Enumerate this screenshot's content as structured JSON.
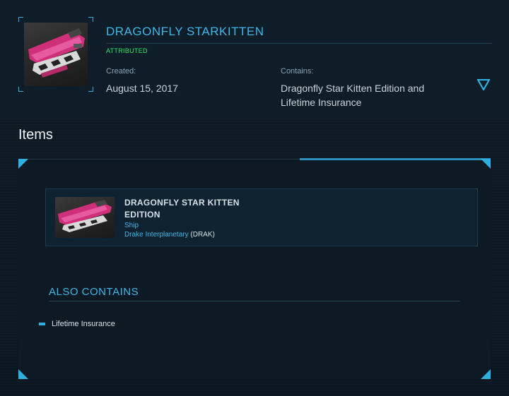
{
  "pledge": {
    "title": "DRAGONFLY STARKITTEN",
    "status": "ATTRIBUTED",
    "created_label": "Created:",
    "created_value": "August 15, 2017",
    "contains_label": "Contains:",
    "contains_value": "Dragonfly Star Kitten Edition and Lifetime Insurance",
    "expand_icon": "triangle-down-icon"
  },
  "items_section": {
    "heading": "Items",
    "items": [
      {
        "name": "DRAGONFLY STAR KITTEN EDITION",
        "type": "Ship",
        "manufacturer": "Drake Interplanetary",
        "manufacturer_code": "(DRAK)"
      }
    ],
    "also_contains_heading": "ALSO CONTAINS",
    "also_contains": [
      "Lifetime Insurance"
    ]
  },
  "colors": {
    "accent": "#3fb6e8",
    "status_green": "#2ee66b",
    "background": "#0c1822"
  }
}
